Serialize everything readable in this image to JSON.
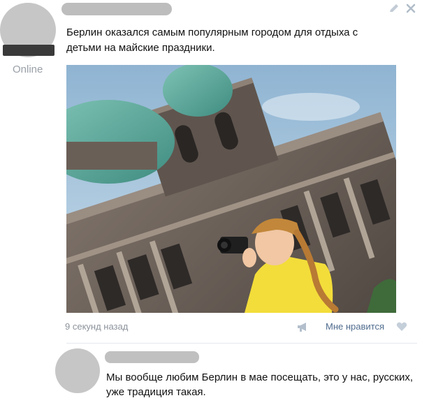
{
  "post": {
    "author_status": "Online",
    "text": "Берлин оказался самым популярным городом для отдыха с детьми на майские праздники.",
    "timestamp": "9 секунд назад",
    "like_label": "Мне нравится"
  },
  "comment": {
    "text": "Мы вообще любим Берлин в мае посещать, это у нас, русских, уже традиция такая."
  },
  "icons": {
    "edit": "pencil-icon",
    "close": "close-icon",
    "share": "megaphone-icon",
    "like": "heart-icon"
  },
  "colors": {
    "link": "#4f6c8e",
    "muted": "#8c939b",
    "icon": "#b3bfcc"
  }
}
